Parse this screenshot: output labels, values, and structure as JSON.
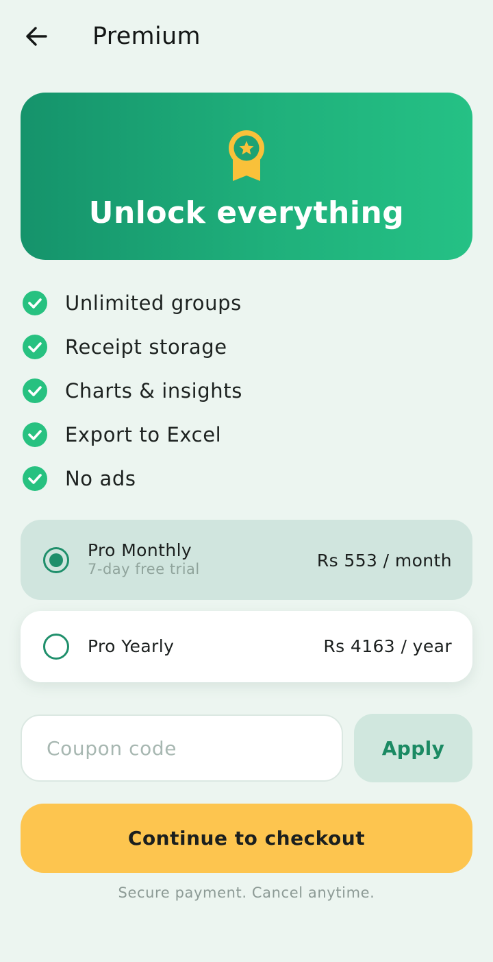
{
  "header": {
    "title": "Premium",
    "back_icon": "arrow-left-icon"
  },
  "hero": {
    "title": "Unlock everything",
    "badge_icon": "award-ribbon-icon",
    "gradient": [
      "#15936b",
      "#25c185"
    ],
    "badge_color": "#f9c13a"
  },
  "features": [
    {
      "label": "Unlimited groups",
      "icon": "check-circle-icon"
    },
    {
      "label": "Receipt storage",
      "icon": "check-circle-icon"
    },
    {
      "label": "Charts & insights",
      "icon": "check-circle-icon"
    },
    {
      "label": "Export to Excel",
      "icon": "check-circle-icon"
    },
    {
      "label": "No ads",
      "icon": "check-circle-icon"
    }
  ],
  "plans": [
    {
      "name": "Pro Monthly",
      "subtitle": "7-day free trial",
      "price": "Rs 553 / month",
      "selected": true
    },
    {
      "name": "Pro Yearly",
      "subtitle": "",
      "price": "Rs 4163 / year",
      "selected": false
    }
  ],
  "coupon": {
    "placeholder": "Coupon code",
    "value": "",
    "apply_label": "Apply"
  },
  "cta": {
    "label": "Continue to checkout"
  },
  "footnote": "Secure payment. Cancel anytime.",
  "colors": {
    "background": "#ecf5f0",
    "accent_green": "#27c180",
    "radio_green": "#1f8f6b",
    "cta_yellow": "#fdc54f"
  }
}
